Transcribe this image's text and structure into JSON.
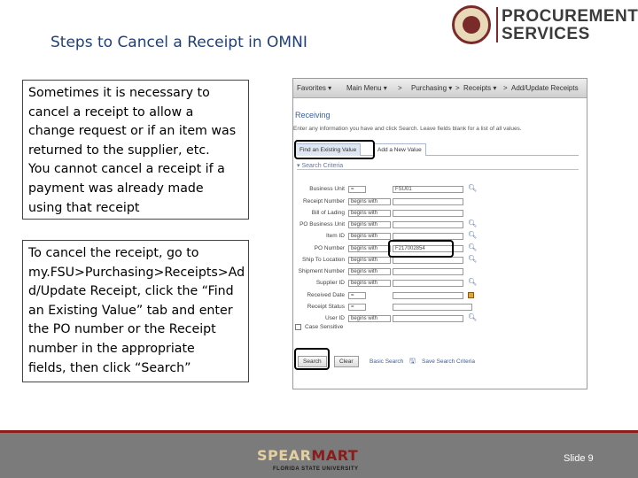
{
  "slide": {
    "title": "Steps to Cancel a Receipt in OMNI",
    "number": "Slide 9"
  },
  "logo": {
    "line1": "PROCUREMENT",
    "line2": "SERVICES"
  },
  "text_boxes": {
    "box1": [
      "Sometimes it is necessary to",
      "cancel a receipt to allow a",
      "change request or if an item was",
      "returned to the supplier, etc.",
      "You cannot cancel a receipt if a",
      "payment was already made",
      "using that receipt"
    ],
    "box2": [
      "To cancel the receipt, go to",
      "my.FSU>Purchasing>Receipts>Ad",
      "d/Update Receipt, click the “Find",
      "an Existing Value” tab and enter",
      "the PO number or the Receipt",
      "number in the appropriate",
      "fields, then click “Search”"
    ]
  },
  "screenshot": {
    "nav": {
      "favorites": "Favorites ▾",
      "main_menu": "Main Menu ▾",
      "sep1": ">",
      "purchasing": "Purchasing ▾",
      "sep2": ">",
      "receipts": "Receipts ▾",
      "sep3": ">",
      "add_update": "Add/Update Receipts"
    },
    "page_heading": "Receiving",
    "instructions": "Enter any information you have and click Search. Leave fields blank for a list of all values.",
    "tabs": {
      "find_existing": "Find an Existing Value",
      "add_new": "Add a New Value"
    },
    "section_header": "Search Criteria",
    "fields": [
      {
        "label": "Business Unit",
        "op": "=",
        "value": "FSU01"
      },
      {
        "label": "Receipt Number",
        "op": "begins with",
        "value": ""
      },
      {
        "label": "Bill of Lading",
        "op": "begins with",
        "value": ""
      },
      {
        "label": "PO Business Unit",
        "op": "begins with",
        "value": ""
      },
      {
        "label": "Item ID",
        "op": "begins with",
        "value": ""
      },
      {
        "label": "PO Number",
        "op": "begins with",
        "value": "F217002854"
      },
      {
        "label": "Ship To Location",
        "op": "begins with",
        "value": ""
      },
      {
        "label": "Shipment Number",
        "op": "begins with",
        "value": ""
      },
      {
        "label": "Supplier ID",
        "op": "begins with",
        "value": ""
      },
      {
        "label": "Received Date",
        "op": "=",
        "value": ""
      },
      {
        "label": "Receipt Status",
        "op": "=",
        "value": ""
      },
      {
        "label": "User ID",
        "op": "begins with",
        "value": ""
      }
    ],
    "case_sensitive": "Case Sensitive",
    "buttons": {
      "search": "Search",
      "clear": "Clear"
    },
    "links": {
      "basic_search": "Basic Search",
      "save_criteria": "Save Search Criteria"
    }
  },
  "footer": {
    "brand_part1": "SPEAR",
    "brand_part2": "MART",
    "brand_sub": "FLORIDA STATE UNIVERSITY"
  },
  "colors": {
    "title": "#1f3f7a",
    "footer_bg": "#7b7b7b",
    "footer_line": "#8a1c1c",
    "garnet": "#7b2a2a",
    "link_blue": "#3a5f9a"
  }
}
